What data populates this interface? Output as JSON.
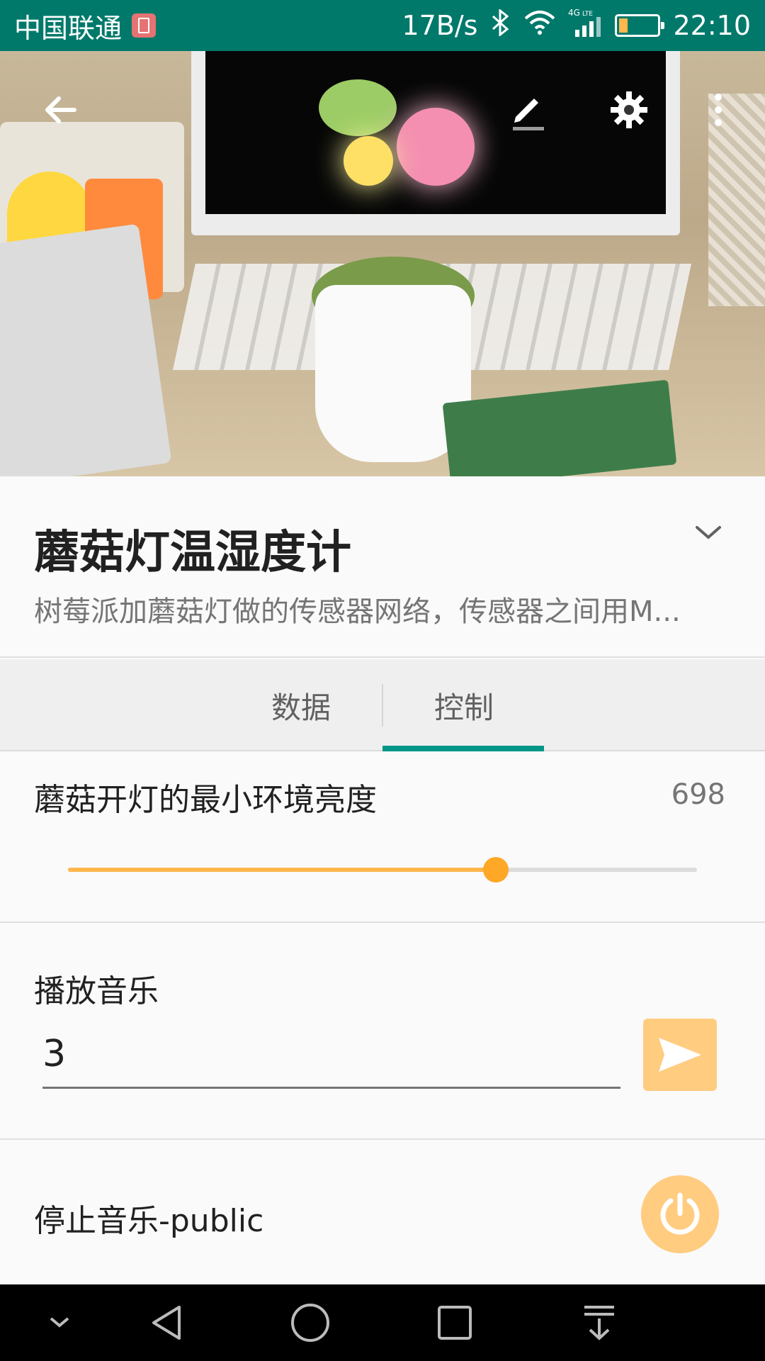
{
  "status_bar": {
    "carrier": "中国联通",
    "network_speed": "17B/s",
    "network_type": "4G LTE",
    "time": "22:10"
  },
  "hero": {
    "image_description_icon": "photo",
    "back_icon": "arrow-back-icon",
    "edit_icon": "edit-icon",
    "settings_icon": "gear-icon",
    "more_icon": "more-vert-icon"
  },
  "device": {
    "title": "蘑菇灯温湿度计",
    "subtitle": "树莓派加蘑菇灯做的传感器网络，传感器之间用M..."
  },
  "tabs": [
    {
      "label": "数据",
      "active": false
    },
    {
      "label": "控制",
      "active": true
    }
  ],
  "controls": {
    "brightness": {
      "label": "蘑菇开灯的最小环境亮度",
      "value": "698",
      "fraction": 0.68
    },
    "music": {
      "label": "播放音乐",
      "input_value": "3"
    },
    "stop_music": {
      "label": "停止音乐-public"
    }
  },
  "colors": {
    "status_bar": "#00796b",
    "accent_tab": "#009688",
    "slider": "#ffb74d",
    "button_orange": "#ffcc80"
  }
}
